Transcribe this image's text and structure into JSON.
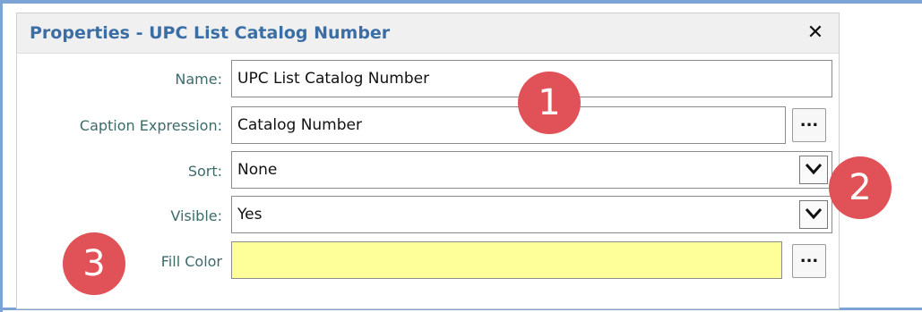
{
  "panel": {
    "title": "Properties - UPC List Catalog Number",
    "close_label": "✕"
  },
  "fields": {
    "name": {
      "label": "Name:",
      "value": "UPC List Catalog Number"
    },
    "caption": {
      "label": "Caption Expression:",
      "value": "Catalog Number",
      "button_label": "..."
    },
    "sort": {
      "label": "Sort:",
      "value": "None"
    },
    "visible": {
      "label": "Visible:",
      "value": "Yes"
    },
    "fill_color": {
      "label": "Fill Color",
      "color": "#ffff99",
      "button_label": "..."
    }
  },
  "callouts": [
    "1",
    "2",
    "3"
  ],
  "colors": {
    "title": "#3a6ea5",
    "label": "#3d6b6b",
    "callout": "#e05257",
    "fill_color_swatch": "#ffff99"
  }
}
